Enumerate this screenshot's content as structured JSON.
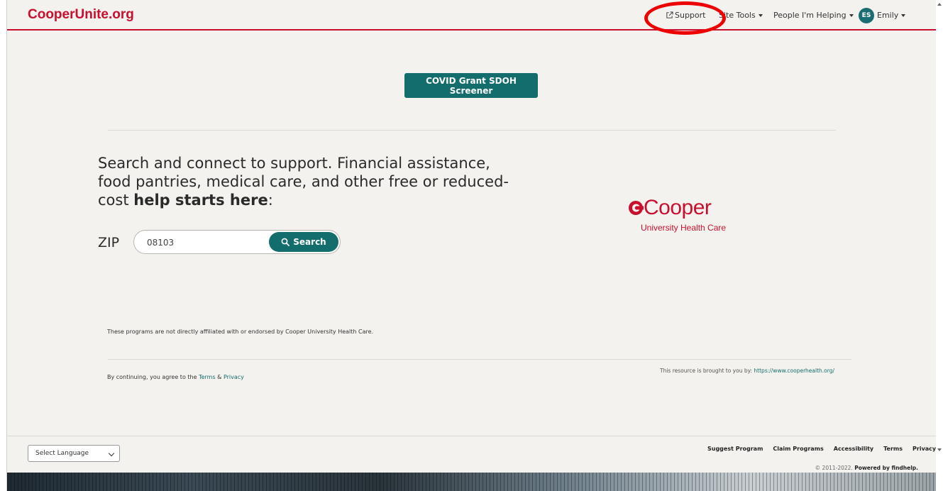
{
  "header": {
    "brand": "CooperUnite.org",
    "nav": {
      "support": "Support",
      "site_tools": "Site Tools",
      "people_helping": "People I'm Helping",
      "user_initials": "ES",
      "user_name": "Emily"
    }
  },
  "main": {
    "screener_button": "COVID Grant SDOH Screener",
    "headline_part1": "Search and connect to support. Financial assistance, food pantries, medical care, and other free or reduced-cost ",
    "headline_bold": "help starts here",
    "headline_end": ":",
    "zip_label": "ZIP",
    "zip_value": "08103",
    "search_button": "Search",
    "logo": {
      "word": "Cooper",
      "sub": "University Health Care"
    },
    "disclaimer": "These programs are not directly affiliated with or endorsed by Cooper University Health Care.",
    "agree_prefix": "By continuing, you agree to the ",
    "agree_terms": "Terms",
    "agree_amp": " & ",
    "agree_privacy": "Privacy",
    "brought_prefix": "This resource is brought to you by: ",
    "brought_link": "https://www.cooperhealth.org/"
  },
  "footer": {
    "language_select": "Select Language",
    "links": [
      "Suggest Program",
      "Claim Programs",
      "Accessibility",
      "Terms",
      "Privacy"
    ],
    "copyright_prefix": "© 2011-2022. ",
    "copyright_bold": "Powered by findhelp."
  },
  "colors": {
    "accent_red": "#c8102e",
    "teal": "#136d6d",
    "annotation_ring": "#ee0000"
  }
}
